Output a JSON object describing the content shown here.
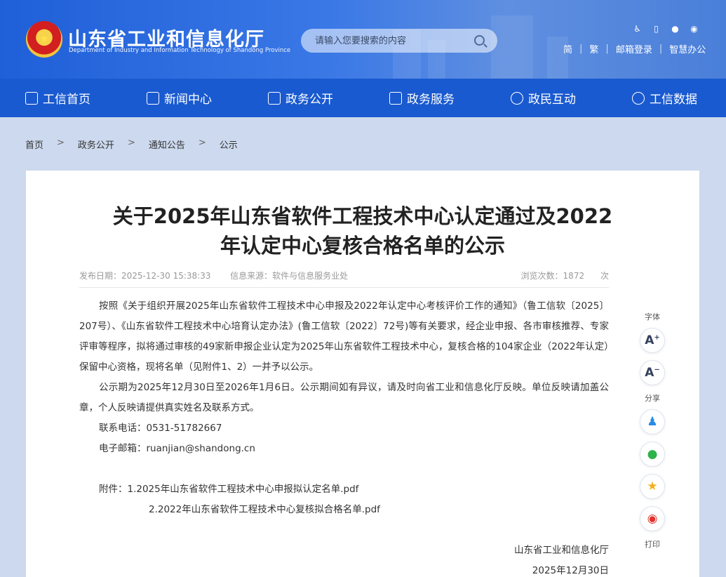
{
  "header": {
    "site_title": "山东省工业和信息化厅",
    "site_subtitle": "Department of Industry and Information Technology of Shandong Province",
    "search_placeholder": "请输入您要搜索的内容",
    "top_links": [
      "简",
      "繁",
      "邮箱登录",
      "智慧办公"
    ]
  },
  "nav": {
    "items": [
      {
        "label": "工信首页",
        "icon": "home-icon"
      },
      {
        "label": "新闻中心",
        "icon": "news-icon"
      },
      {
        "label": "政务公开",
        "icon": "monitor-icon"
      },
      {
        "label": "政务服务",
        "icon": "service-icon"
      },
      {
        "label": "政民互动",
        "icon": "chat-icon"
      },
      {
        "label": "工信数据",
        "icon": "database-icon"
      }
    ]
  },
  "breadcrumb": [
    "首页",
    "政务公开",
    "通知公告",
    "公示"
  ],
  "article": {
    "title_line1": "关于2025年山东省软件工程技术中心认定通过及2022",
    "title_line2": "年认定中心复核合格名单的公示",
    "publish_label": "发布日期：",
    "publish_date": "2025-12-30 15:38:33",
    "source_label": "信息来源：",
    "source": "软件与信息服务业处",
    "views_label": "浏览次数：",
    "views": "1872",
    "views_unit": "次",
    "para1": "按照《关于组织开展2025年山东省软件工程技术中心申报及2022年认定中心考核评价工作的通知》（鲁工信软〔2025〕207号）、《山东省软件工程技术中心培育认定办法》(鲁工信软〔2022〕72号)等有关要求，经企业申报、各市审核推荐、专家评审等程序，拟将通过审核的49家新申报企业认定为2025年山东省软件工程技术中心，复核合格的104家企业（2022年认定）保留中心资格，现将名单（见附件1、2）一并予以公示。",
    "para2": "公示期为2025年12月30日至2026年1月6日。公示期间如有异议，请及时向省工业和信息化厅反映。单位反映请加盖公章，个人反映请提供真实姓名及联系方式。",
    "phone_line": "联系电话：0531-51782667",
    "email_line": "电子邮箱：ruanjian@shandong.cn",
    "attachment1": "附件：1.2025年山东省软件工程技术中心申报拟认定名单.pdf",
    "attachment2": "2.2022年山东省软件工程技术中心复核拟合格名单.pdf",
    "signature": "山东省工业和信息化厅",
    "sign_date": "2025年12月30日"
  },
  "side_tools": {
    "font_label": "字体",
    "share_label": "分享",
    "print_label": "打印"
  }
}
